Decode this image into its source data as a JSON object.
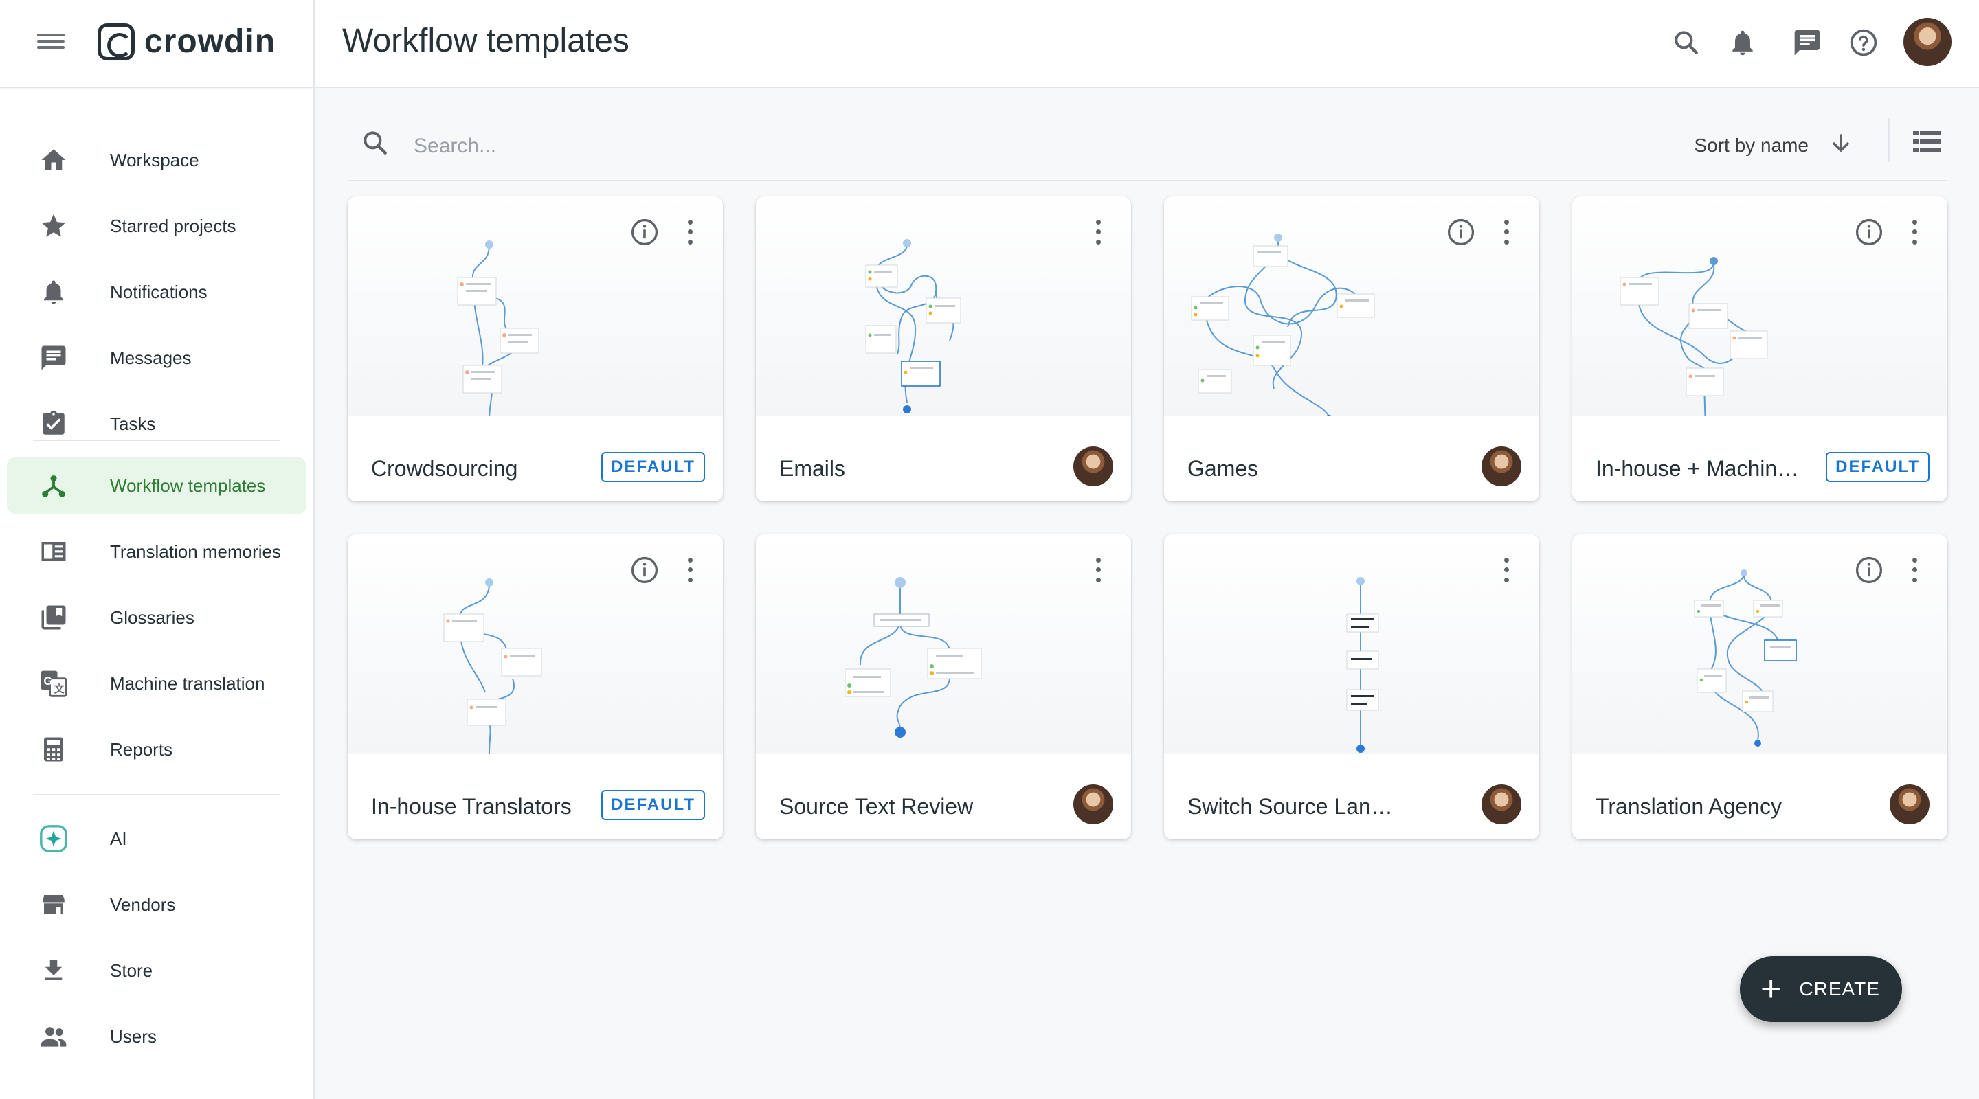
{
  "app": {
    "brand": "crowdin"
  },
  "header": {
    "title": "Workflow templates",
    "icons": [
      "search-icon",
      "bell-icon",
      "chat-icon",
      "help-icon"
    ]
  },
  "sidebar": {
    "items": [
      {
        "label": "Workspace",
        "icon": "home-icon"
      },
      {
        "label": "Starred projects",
        "icon": "star-icon"
      },
      {
        "label": "Notifications",
        "icon": "bell-icon"
      },
      {
        "label": "Messages",
        "icon": "chat-icon"
      },
      {
        "label": "Tasks",
        "icon": "clipboard-check-icon"
      },
      {
        "label": "Workflow templates",
        "icon": "workflow-icon",
        "active": true
      },
      {
        "label": "Translation memories",
        "icon": "book-icon"
      },
      {
        "label": "Glossaries",
        "icon": "library-icon"
      },
      {
        "label": "Machine translation",
        "icon": "translate-icon"
      },
      {
        "label": "Reports",
        "icon": "calculator-icon"
      },
      {
        "label": "AI",
        "icon": "sparkle-icon"
      },
      {
        "label": "Vendors",
        "icon": "store-icon"
      },
      {
        "label": "Store",
        "icon": "download-icon"
      },
      {
        "label": "Users",
        "icon": "people-icon"
      }
    ]
  },
  "toolbar": {
    "search_placeholder": "Search...",
    "sort_label": "Sort by name"
  },
  "cards": [
    {
      "name": "Crowdsourcing",
      "badge": "DEFAULT",
      "info": true
    },
    {
      "name": "Emails",
      "badge": "",
      "info": false
    },
    {
      "name": "Games",
      "badge": "",
      "info": true
    },
    {
      "name": "In-house + Machine ...",
      "badge": "DEFAULT",
      "info": true
    },
    {
      "name": "In-house Translators",
      "badge": "DEFAULT",
      "info": true
    },
    {
      "name": "Source Text Review",
      "badge": "",
      "info": false
    },
    {
      "name": "Switch Source Language",
      "badge": "",
      "info": false
    },
    {
      "name": "Translation Agency",
      "badge": "",
      "info": true
    }
  ],
  "fab": {
    "label": "CREATE"
  },
  "colors": {
    "accent_green": "#2e7d32",
    "badge_blue": "#1976d2",
    "fab_dark": "#263238",
    "flow_blue": "#5b9bd5"
  }
}
